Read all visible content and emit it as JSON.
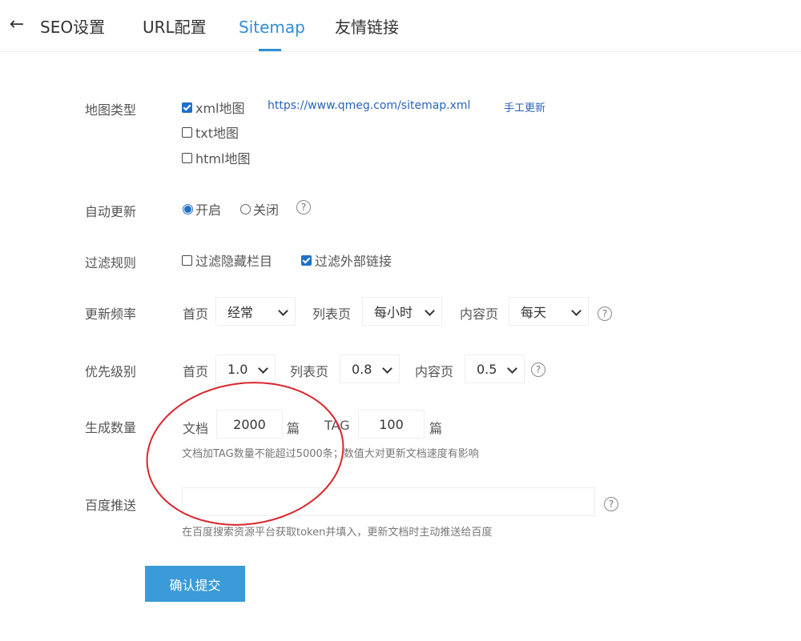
{
  "header": {
    "back_icon": "arrow-left-icon",
    "tabs": [
      {
        "label": "SEO设置",
        "active": false
      },
      {
        "label": "URL配置",
        "active": false
      },
      {
        "label": "Sitemap",
        "active": true
      },
      {
        "label": "友情链接",
        "active": false
      }
    ],
    "accent_color": "#2f8fd2"
  },
  "map_type": {
    "label": "地图类型",
    "options": [
      {
        "label": "xml地图",
        "checked": true
      },
      {
        "label": "txt地图",
        "checked": false
      },
      {
        "label": "html地图",
        "checked": false
      }
    ],
    "xml_url": "https://www.qmeg.com/sitemap.xml",
    "manual_update_link": "手工更新"
  },
  "auto_update": {
    "label": "自动更新",
    "options": [
      {
        "label": "开启",
        "selected": true
      },
      {
        "label": "关闭",
        "selected": false
      }
    ],
    "help_icon": "question-circle-icon"
  },
  "filter_rules": {
    "label": "过滤规则",
    "options": [
      {
        "label": "过滤隐藏栏目",
        "checked": false
      },
      {
        "label": "过滤外部链接",
        "checked": true
      }
    ]
  },
  "update_frequency": {
    "label": "更新频率",
    "home_label": "首页",
    "home_value": "经常",
    "list_label": "列表页",
    "list_value": "每小时",
    "content_label": "内容页",
    "content_value": "每天"
  },
  "priority": {
    "label": "优先级别",
    "home_label": "首页",
    "home_value": "1.0",
    "list_label": "列表页",
    "list_value": "0.8",
    "content_label": "内容页",
    "content_value": "0.5"
  },
  "generate_count": {
    "label": "生成数量",
    "doc_label": "文档",
    "doc_value": "2000",
    "doc_unit": "篇",
    "tag_label": "TAG",
    "tag_value": "100",
    "tag_unit": "篇",
    "hint": "文档加TAG数量不能超过5000条；数值大对更新文档速度有影响"
  },
  "baidu_push": {
    "label": "百度推送",
    "token_value": "",
    "hint": "在百度搜索资源平台获取token并填入，更新文档时主动推送给百度"
  },
  "submit_label": "确认提交",
  "annotation_color": "#d9272e"
}
